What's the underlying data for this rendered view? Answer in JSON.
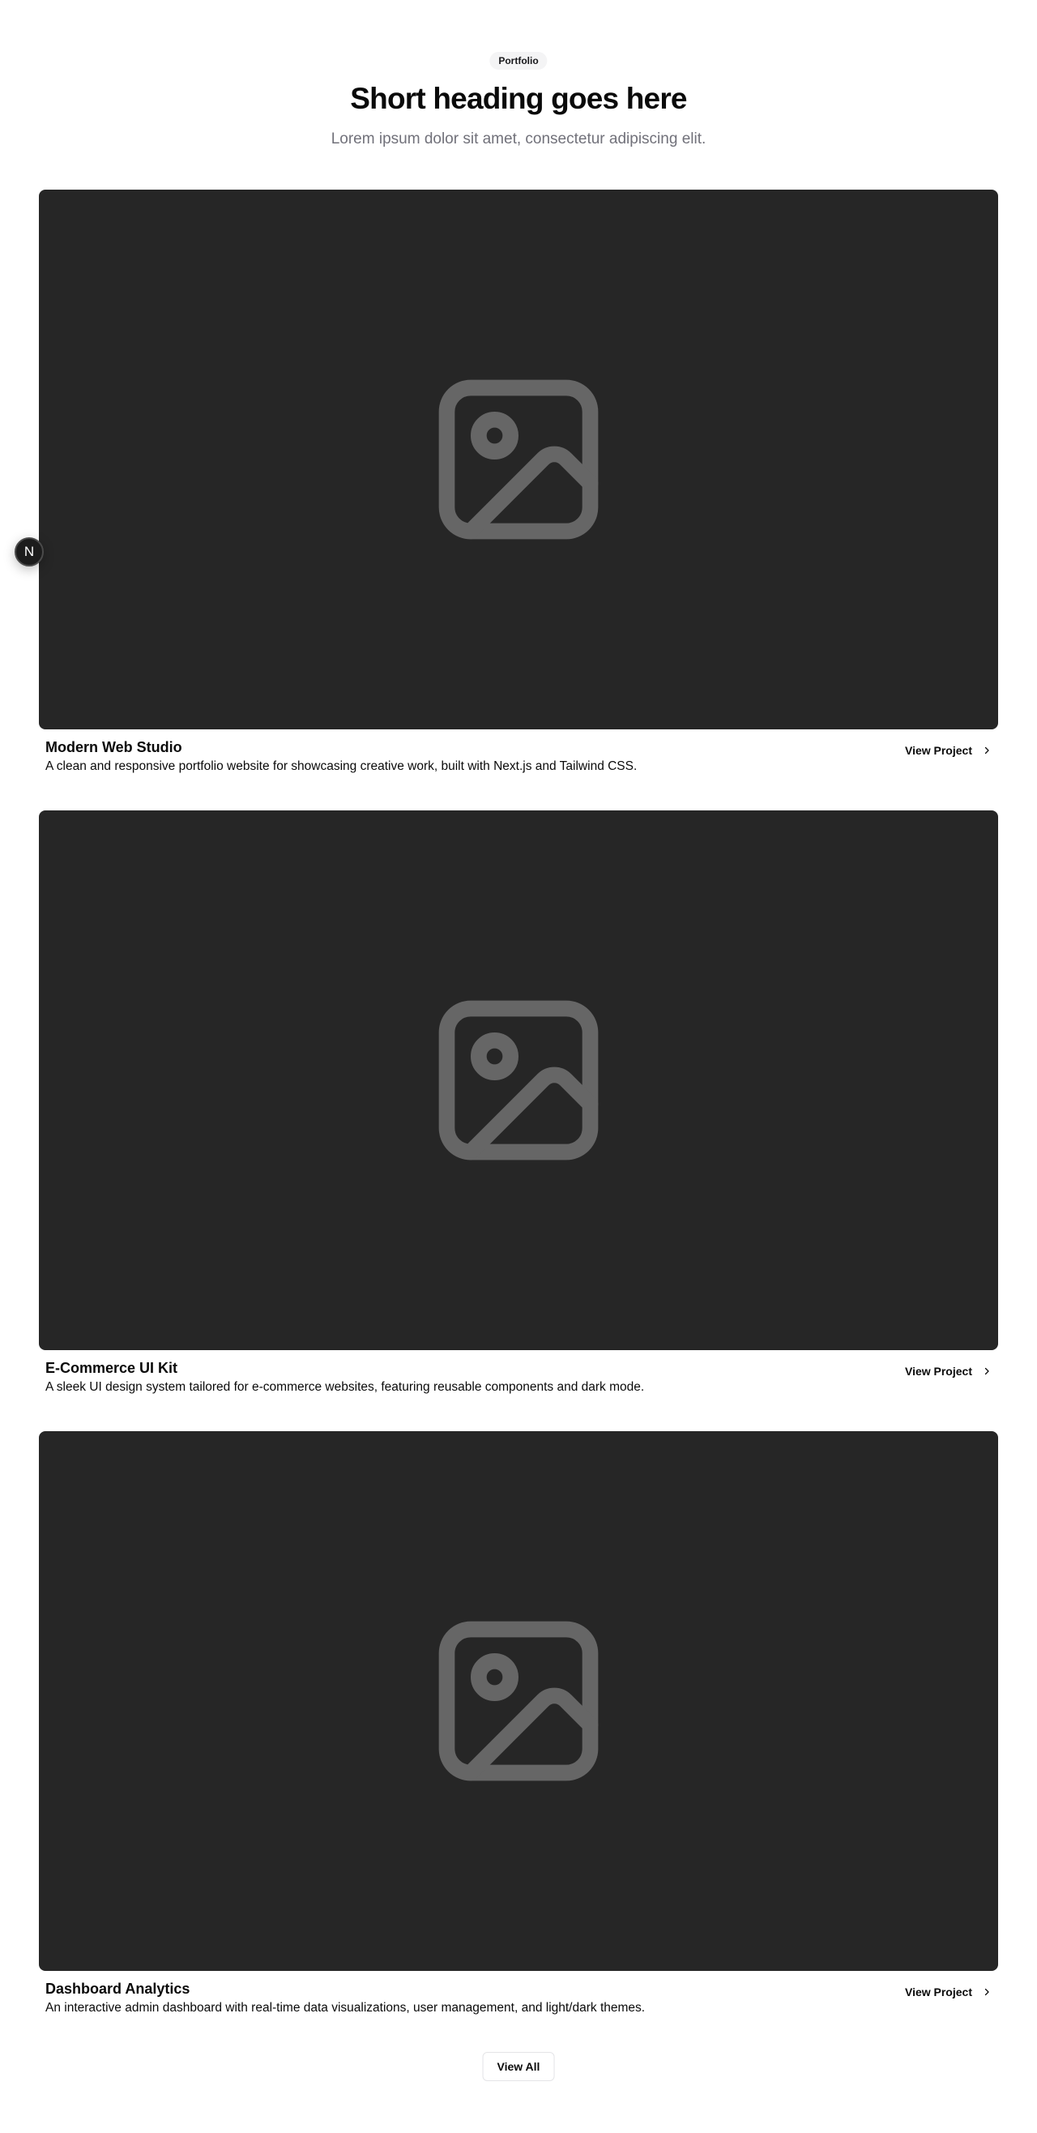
{
  "header": {
    "badge": "Portfolio",
    "title": "Short heading goes here",
    "subtitle": "Lorem ipsum dolor sit amet, consectetur adipiscing elit."
  },
  "projects": [
    {
      "title": "Modern Web Studio",
      "description": "A clean and responsive portfolio website for showcasing creative work, built with Next.js and Tailwind CSS.",
      "link_label": "View Project",
      "image_icon": "image-placeholder-icon"
    },
    {
      "title": "E-Commerce UI Kit",
      "description": "A sleek UI design system tailored for e-commerce websites, featuring reusable components and dark mode.",
      "link_label": "View Project",
      "image_icon": "image-placeholder-icon"
    },
    {
      "title": "Dashboard Analytics",
      "description": "An interactive admin dashboard with real-time data visualizations, user management, and light/dark themes.",
      "link_label": "View Project",
      "image_icon": "image-placeholder-icon"
    }
  ],
  "view_all_label": "View All",
  "floating_badge": {
    "letter": "N",
    "icon": "nextjs-logo-icon"
  },
  "colors": {
    "image_background": "#262626",
    "image_icon": "#666666",
    "badge_background": "#f4f4f5",
    "subtitle_text": "#71717a"
  }
}
